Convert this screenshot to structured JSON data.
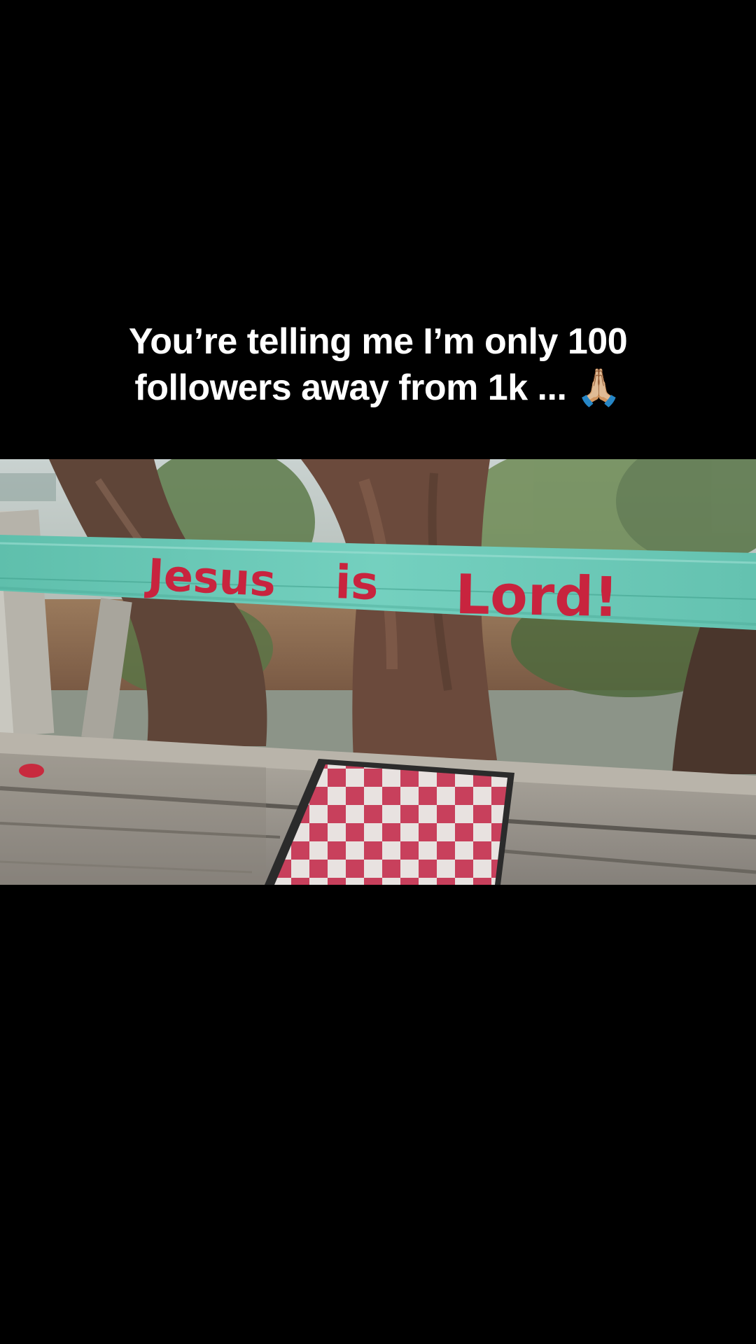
{
  "caption": {
    "line1": "You’re telling me I’m only 100",
    "line2": "followers away from 1k ... 🙏🏼"
  },
  "photo": {
    "sign_words": [
      "Jesus",
      "is",
      "Lord!"
    ],
    "colors": {
      "sign_board": "#6cc9b7",
      "sign_letters": "#c8243e",
      "checker_red": "#c8405c",
      "checker_white": "#e8e2e0",
      "wood": "#9a958c",
      "trunk": "#6b4a3c"
    }
  }
}
